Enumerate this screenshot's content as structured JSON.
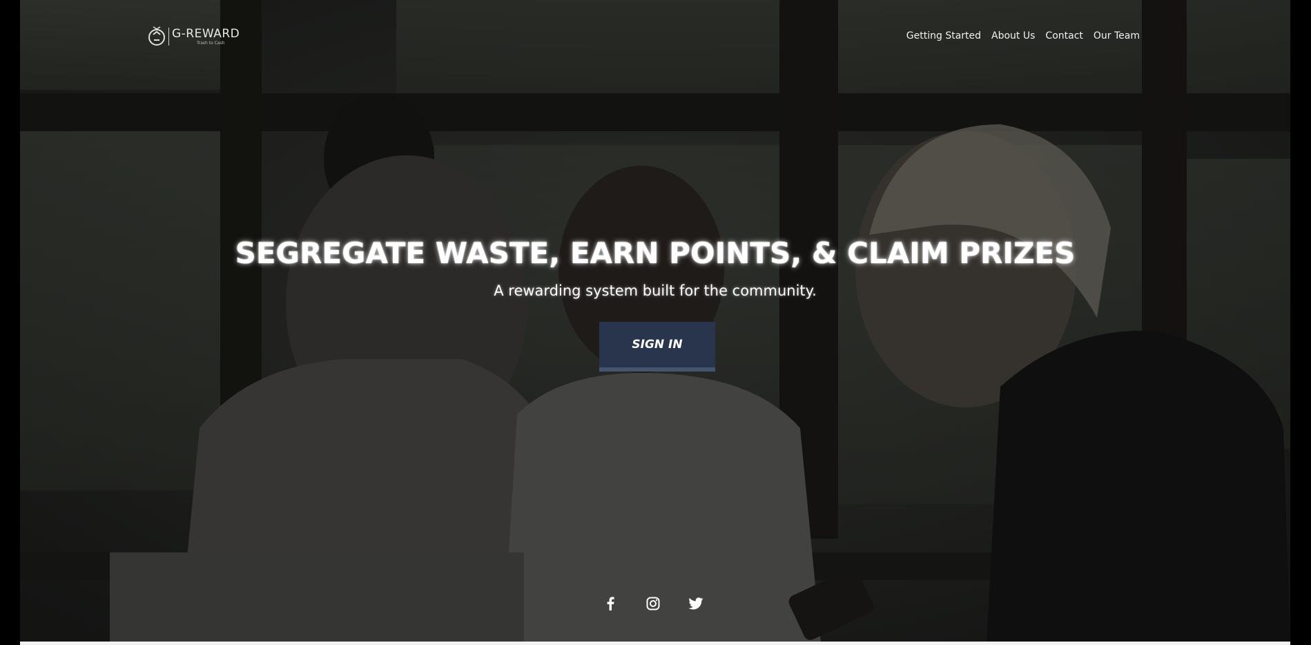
{
  "brand": {
    "name": "G-REWARD",
    "tagline": "Trash to Cash",
    "logo_icon": "recycle-seal-icon"
  },
  "nav": {
    "items": [
      {
        "label": "Getting Started"
      },
      {
        "label": "About Us"
      },
      {
        "label": "Contact"
      },
      {
        "label": "Our Team"
      }
    ]
  },
  "hero": {
    "headline": "SEGREGATE WASTE, EARN POINTS, & CLAIM PRIZES",
    "subheadline": "A rewarding system built for the community.",
    "cta_label": "SIGN IN",
    "background_description_icon": "photo-three-people-looking-at-phone"
  },
  "social": {
    "icons": [
      "facebook-icon",
      "instagram-icon",
      "twitter-icon"
    ]
  },
  "colors": {
    "cta_background": "#29354c",
    "cta_bottom_border": "#46556f",
    "text": "#ffffff",
    "overlay": "#000000"
  }
}
